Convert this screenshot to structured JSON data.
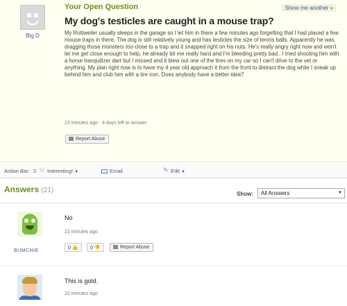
{
  "question": {
    "header": "Your Open Question",
    "show_another": "Show me another »",
    "asker_name": "Big D",
    "title": "My dog's testicles are caught in a mouse trap?",
    "body": "My Rottweiler usually sleeps in the garage so I let him in there a few minutes ago forgetting that I had placed a few mouse traps in there. The dog is still relatively young and has testicles the size of tennis balls. Apparently he was dragging those monsters too close to a trap and it snapped right on his nuts. He's really angry right now and won't let me get close enough to help, he already bit me really hard and I'm bleeding pretty bad.. I tried shooting him with a horse tranquilizer dart but I missed and it blew out one of the tires on my car so I can't drive to the vet or anything. My plan right now is to have my 4 year old approach it from the front to distract the dog while I sneak up behind him and club him with a tire iron. Does anybody have a better idea?",
    "meta": "23 minutes ago - 4 days left to answer.",
    "report_label": "Report Abuse"
  },
  "action_bar": {
    "label": "Action Bar:",
    "count": "2",
    "interesting": "Interesting!",
    "email": "Email",
    "edit": "Edit"
  },
  "answers": {
    "title": "Answers",
    "count": "(21)",
    "show_label": "Show:",
    "show_value": "All Answers",
    "items": [
      {
        "user": "BUMCHIE",
        "text": "No",
        "meta": "22 minutes ago",
        "up": "0",
        "down": "0",
        "report": "Report Abuse"
      },
      {
        "text": "This is gold.",
        "meta": "22 minutes ago"
      }
    ]
  }
}
